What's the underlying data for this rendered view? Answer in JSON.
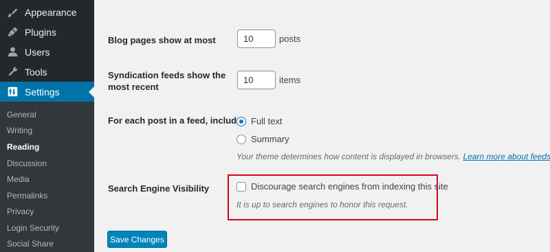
{
  "sidebar": {
    "menu": [
      {
        "label": "Appearance",
        "icon": "brush-icon"
      },
      {
        "label": "Plugins",
        "icon": "plugin-icon"
      },
      {
        "label": "Users",
        "icon": "user-icon"
      },
      {
        "label": "Tools",
        "icon": "wrench-icon"
      },
      {
        "label": "Settings",
        "icon": "settings-icon",
        "active": true
      }
    ],
    "submenu": [
      {
        "label": "General"
      },
      {
        "label": "Writing"
      },
      {
        "label": "Reading",
        "current": true
      },
      {
        "label": "Discussion"
      },
      {
        "label": "Media"
      },
      {
        "label": "Permalinks"
      },
      {
        "label": "Privacy"
      },
      {
        "label": "Login Security"
      },
      {
        "label": "Social Share"
      }
    ]
  },
  "form": {
    "blog_pages": {
      "label": "Blog pages show at most",
      "value": "10",
      "unit": "posts"
    },
    "syndication": {
      "label_line1": "Syndication feeds show the",
      "label_line2": "most recent",
      "value": "10",
      "unit": "items"
    },
    "feed_include": {
      "label": "For each post in a feed, include",
      "options": [
        {
          "label": "Full text",
          "checked": true
        },
        {
          "label": "Summary",
          "checked": false
        }
      ],
      "description": "Your theme determines how content is displayed in browsers.",
      "link_text": "Learn more about feeds",
      "link_suffix": "."
    },
    "search_visibility": {
      "label": "Search Engine Visibility",
      "checkbox_label": "Discourage search engines from indexing this site",
      "checked": false,
      "description": "It is up to search engines to honor this request."
    },
    "save_label": "Save Changes"
  },
  "colors": {
    "sidebar_bg": "#23282d",
    "submenu_bg": "#32373c",
    "accent": "#0073aa",
    "button": "#0085ba",
    "highlight": "#d0021b"
  }
}
